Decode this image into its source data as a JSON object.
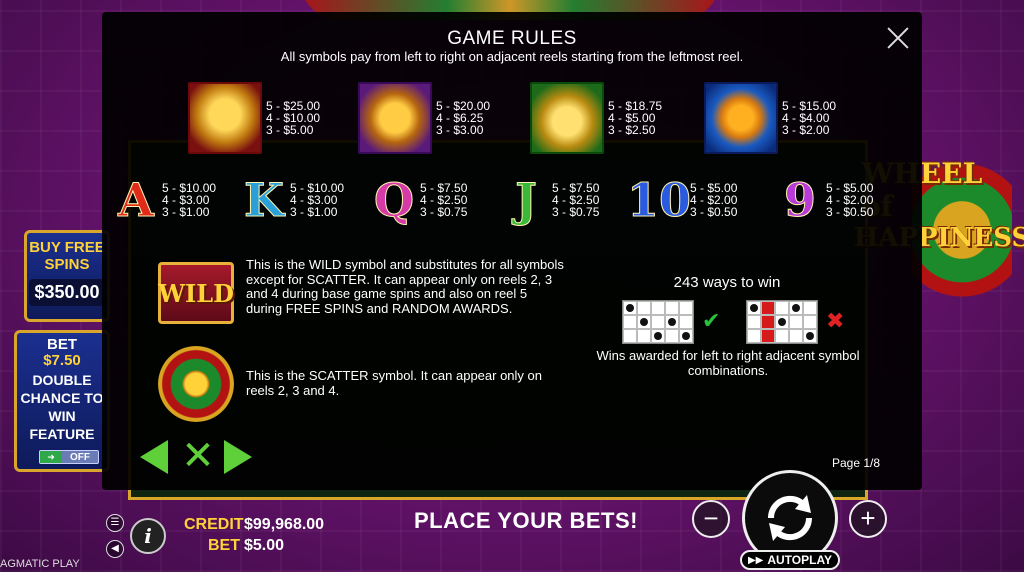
{
  "dialog": {
    "title": "GAME RULES",
    "subtitle": "All symbols pay from left to right on adjacent reels starting from the leftmost reel.",
    "page": "Page 1/8"
  },
  "high_symbols": [
    {
      "icon": "dragon-symbol-icon",
      "pays": "5 - $25.00\n4 - $10.00\n3 - $5.00"
    },
    {
      "icon": "lion-symbol-icon",
      "pays": "5 - $20.00\n4 - $6.25\n3 - $3.00"
    },
    {
      "icon": "turtle-symbol-icon",
      "pays": "5 - $18.75\n4 - $5.00\n3 - $2.50"
    },
    {
      "icon": "koi-symbol-icon",
      "pays": "5 - $15.00\n4 - $4.00\n3 - $2.00"
    }
  ],
  "low_symbols": [
    {
      "glyph": "A",
      "color": "#e02a1a",
      "pays": "5 - $10.00\n4 - $3.00\n3 - $1.00"
    },
    {
      "glyph": "K",
      "color": "#2aa0d8",
      "pays": "5 - $10.00\n4 - $3.00\n3 - $1.00"
    },
    {
      "glyph": "Q",
      "color": "#d63aa8",
      "pays": "5 - $7.50\n4 - $2.50\n3 - $0.75"
    },
    {
      "glyph": "J",
      "color": "#3ab83a",
      "pays": "5 - $7.50\n4 - $2.50\n3 - $0.75"
    },
    {
      "glyph": "10",
      "color": "#2a5ae0",
      "pays": "5 - $5.00\n4 - $2.00\n3 - $0.50"
    },
    {
      "glyph": "9",
      "color": "#b83ad8",
      "pays": "5 - $5.00\n4 - $2.00\n3 - $0.50"
    }
  ],
  "wild": {
    "label": "WILD",
    "text": "This is the WILD symbol and substitutes for all symbols except for SCATTER. It can appear only on reels 2, 3 and 4 during base game spins and also on reel 5 during FREE SPINS and RANDOM AWARDS."
  },
  "scatter": {
    "text": "This is the SCATTER symbol. It can appear only on reels 2, 3 and 4."
  },
  "ways": {
    "title": "243 ways to win",
    "description": "Wins awarded for left to right adjacent symbol combinations."
  },
  "side": {
    "buy_label": "BUY FREE SPINS",
    "buy_price": "$350.00",
    "bet_label": "BET",
    "bet_value": "$7.50",
    "feature_text": "DOUBLE CHANCE TO WIN FEATURE",
    "toggle_label": "OFF"
  },
  "logo": {
    "line1": "WHEEL of",
    "line2": "HAPPINESS"
  },
  "footer": {
    "credit_label": "CREDIT",
    "credit_value": "$99,968.00",
    "bet_label": "BET",
    "bet_value": "$5.00",
    "status": "PLACE YOUR BETS!",
    "autoplay_label": "AUTOPLAY",
    "brand": "AGMATIC PLAY"
  },
  "colors": {
    "accent": "#ffd23a",
    "nav_green": "#5fcf3a",
    "check": "#25c43a",
    "cross": "#e02222"
  }
}
